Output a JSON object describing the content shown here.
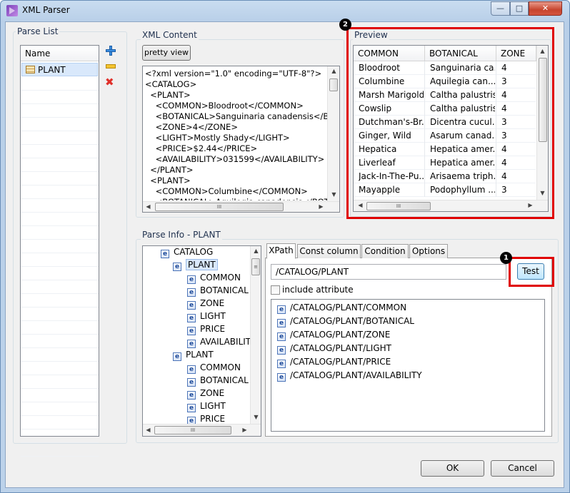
{
  "window": {
    "title": "XML Parser",
    "min_glyph": "—",
    "max_glyph": "□",
    "close_glyph": "✕"
  },
  "parse_list": {
    "group_label": "Parse List",
    "column_header": "Name",
    "items": [
      {
        "label": "PLANT",
        "icon": "table-icon"
      }
    ],
    "tools": {
      "add": "add-icon",
      "edit": "edit-icon",
      "delete": "delete-icon"
    }
  },
  "xml_content": {
    "group_label": "XML Content",
    "pretty_view_label": "pretty view",
    "lines": [
      "<?xml version=\"1.0\" encoding=\"UTF-8\"?>",
      "<CATALOG>",
      "  <PLANT>",
      "    <COMMON>Bloodroot</COMMON>",
      "    <BOTANICAL>Sanguinaria canadensis</BO",
      "    <ZONE>4</ZONE>",
      "    <LIGHT>Mostly Shady</LIGHT>",
      "    <PRICE>$2.44</PRICE>",
      "    <AVAILABILITY>031599</AVAILABILITY>",
      "  </PLANT>",
      "  <PLANT>",
      "    <COMMON>Columbine</COMMON>",
      "    <BOTANICAL>Aquilegia canadensis</BOT"
    ]
  },
  "preview": {
    "group_label": "Preview",
    "badge": "2",
    "columns": [
      "COMMON",
      "BOTANICAL",
      "ZONE"
    ],
    "rows": [
      [
        "Bloodroot",
        "Sanguinaria ca...",
        "4"
      ],
      [
        "Columbine",
        "Aquilegia can...",
        "3"
      ],
      [
        "Marsh Marigold",
        "Caltha palustris",
        "4"
      ],
      [
        "Cowslip",
        "Caltha palustris",
        "4"
      ],
      [
        "Dutchman's-Br...",
        "Dicentra cucul...",
        "3"
      ],
      [
        "Ginger, Wild",
        "Asarum canad...",
        "3"
      ],
      [
        "Hepatica",
        "Hepatica amer...",
        "4"
      ],
      [
        "Liverleaf",
        "Hepatica amer...",
        "4"
      ],
      [
        "Jack-In-The-Pu...",
        "Arisaema triph...",
        "4"
      ],
      [
        "Mayapple",
        "Podophyllum ...",
        "3"
      ]
    ]
  },
  "parse_info": {
    "group_label": "Parse Info - PLANT",
    "tree": [
      {
        "label": "CATALOG",
        "level": 0,
        "selected": false
      },
      {
        "label": "PLANT",
        "level": 1,
        "selected": true
      },
      {
        "label": "COMMON",
        "level": 2,
        "selected": false
      },
      {
        "label": "BOTANICAL",
        "level": 2,
        "selected": false
      },
      {
        "label": "ZONE",
        "level": 2,
        "selected": false
      },
      {
        "label": "LIGHT",
        "level": 2,
        "selected": false
      },
      {
        "label": "PRICE",
        "level": 2,
        "selected": false
      },
      {
        "label": "AVAILABILITY",
        "level": 2,
        "selected": false
      },
      {
        "label": "PLANT",
        "level": 1,
        "selected": false
      },
      {
        "label": "COMMON",
        "level": 2,
        "selected": false
      },
      {
        "label": "BOTANICAL",
        "level": 2,
        "selected": false
      },
      {
        "label": "ZONE",
        "level": 2,
        "selected": false
      },
      {
        "label": "LIGHT",
        "level": 2,
        "selected": false
      },
      {
        "label": "PRICE",
        "level": 2,
        "selected": false
      }
    ],
    "tabs": [
      "XPath",
      "Const column",
      "Condition",
      "Options"
    ],
    "active_tab": "XPath",
    "xpath_value": "/CATALOG/PLANT",
    "test_label": "Test",
    "test_badge": "1",
    "include_attribute_label": "include attribute",
    "include_attribute_checked": false,
    "xpaths": [
      "/CATALOG/PLANT/COMMON",
      "/CATALOG/PLANT/BOTANICAL",
      "/CATALOG/PLANT/ZONE",
      "/CATALOG/PLANT/LIGHT",
      "/CATALOG/PLANT/PRICE",
      "/CATALOG/PLANT/AVAILABILITY"
    ]
  },
  "footer": {
    "ok_label": "OK",
    "cancel_label": "Cancel"
  },
  "scroll": {
    "left_arrow": "◀",
    "right_arrow": "▶",
    "up_arrow": "▲",
    "down_arrow": "▼",
    "grip": "III"
  },
  "colors": {
    "highlight_red": "#e00000",
    "selection": "#d9e8fb",
    "accent_blue": "#3c7fb1"
  }
}
